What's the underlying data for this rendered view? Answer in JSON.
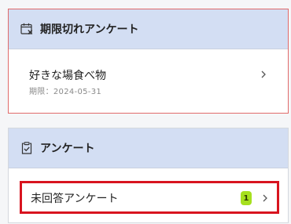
{
  "expired_section": {
    "title": "期限切れアンケート",
    "items": [
      {
        "label": "好きな場食べ物",
        "deadline": "期限：2024-05-31"
      }
    ]
  },
  "survey_section": {
    "title": "アンケート",
    "items": [
      {
        "label": "未回答アンケート",
        "badge_count": "1"
      }
    ]
  },
  "colors": {
    "header_bg": "#d3def3",
    "expired_border": "#e06a6a",
    "highlight_border": "#d8141f",
    "badge_bg": "#a6e01f"
  },
  "icons": {
    "expired_header": "calendar-x-icon",
    "survey_header": "clipboard-check-icon",
    "row_chevron": "chevron-right-icon"
  }
}
